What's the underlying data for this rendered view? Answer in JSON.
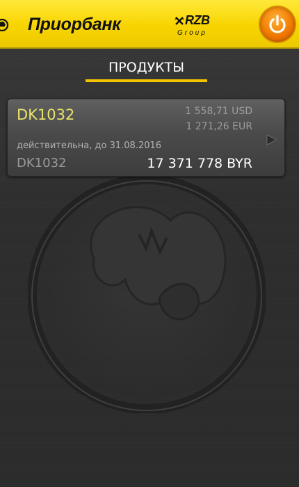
{
  "header": {
    "brand": "Приорбанк",
    "partner_logo": "RZB",
    "partner_sub": "Group",
    "power_icon": "power-icon"
  },
  "tabs": [
    {
      "label": "ПРОДУКТЫ",
      "active": true
    }
  ],
  "products": [
    {
      "name": "DK1032",
      "usd": "1 558,71 USD",
      "eur": "1 271,26 EUR",
      "validity": "действительна, до 31.08.2016",
      "account": "DK1032",
      "byr": "17 371 778 BYR",
      "action_icon": "play-arrow-icon"
    }
  ],
  "colors": {
    "header_yellow": "#f7d400",
    "accent_underline": "#f5c400",
    "card_title": "#e9e36b",
    "power_orange": "#f07a00"
  }
}
